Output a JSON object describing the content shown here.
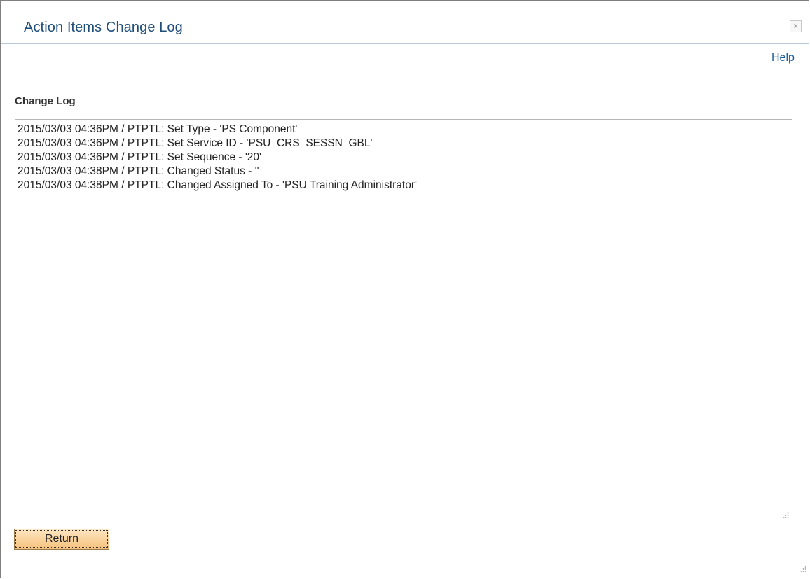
{
  "modal": {
    "title": "Action Items Change Log",
    "close_symbol": "×",
    "close_icon": "close-icon"
  },
  "help_link": "Help",
  "change_log": {
    "label": "Change Log",
    "lines": [
      "2015/03/03 04:36PM / PTPTL: Set Type - 'PS Component'",
      "2015/03/03 04:36PM / PTPTL: Set Service ID - 'PSU_CRS_SESSN_GBL'",
      "2015/03/03 04:36PM / PTPTL: Set Sequence - '20'",
      "2015/03/03 04:38PM / PTPTL: Changed Status - ''",
      "2015/03/03 04:38PM / PTPTL: Changed Assigned To - 'PSU Training Administrator'"
    ],
    "resize_icon": "resize-grip-icon"
  },
  "buttons": {
    "return_label": "Return"
  },
  "colors": {
    "title": "#1f4e79",
    "link": "#1a5f9c",
    "button_bg": "#fbd7a2"
  }
}
